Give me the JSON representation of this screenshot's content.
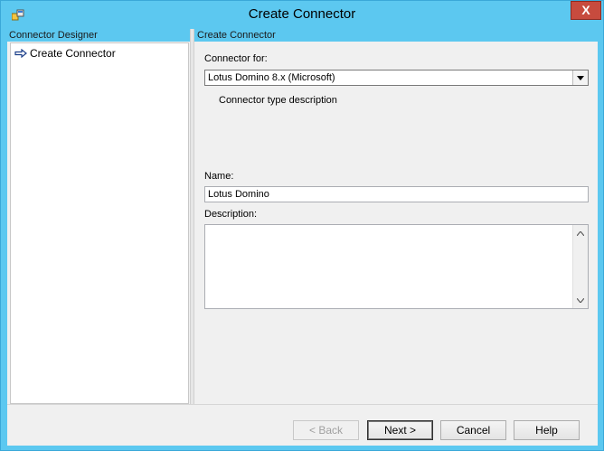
{
  "window": {
    "title": "Create Connector",
    "close_glyph": "X",
    "icon": "app-icon"
  },
  "left_panel": {
    "header": "Connector Designer",
    "items": [
      {
        "label": "Create Connector",
        "icon": "arrow-right-icon",
        "selected": true
      }
    ]
  },
  "right_panel": {
    "header": "Create Connector",
    "connector_for_label": "Connector for:",
    "connector_for_value": "Lotus Domino 8.x (Microsoft)",
    "connector_type_description": "Connector type description",
    "name_label": "Name:",
    "name_value": "Lotus Domino",
    "description_label": "Description:",
    "description_value": ""
  },
  "buttons": {
    "back": "< Back",
    "next": "Next >",
    "cancel": "Cancel",
    "help": "Help"
  },
  "colors": {
    "title_bar": "#5cc8f0",
    "close_button": "#c74b3e",
    "panel_background": "#f0f0f0"
  }
}
